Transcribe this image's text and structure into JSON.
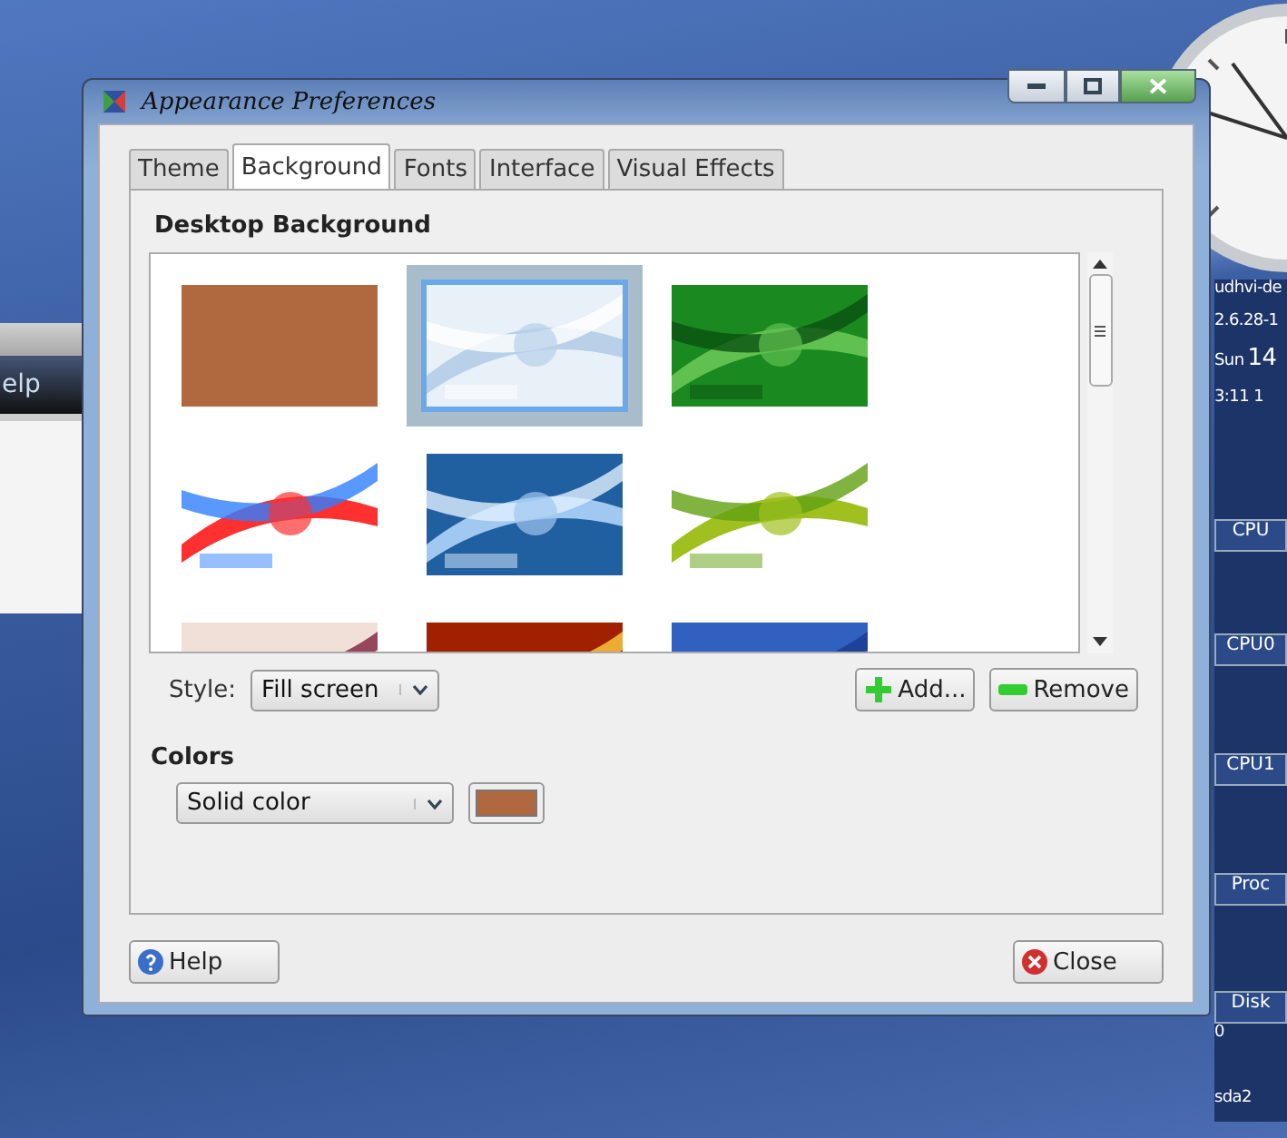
{
  "window": {
    "title": "Appearance Preferences"
  },
  "tabs": [
    {
      "label": "Theme",
      "selected": false
    },
    {
      "label": "Background",
      "selected": true
    },
    {
      "label": "Fonts",
      "selected": false
    },
    {
      "label": "Interface",
      "selected": false
    },
    {
      "label": "Visual Effects",
      "selected": false
    }
  ],
  "background": {
    "heading": "Desktop Background",
    "wallpapers": [
      {
        "kind": "solid",
        "color": "#b0693f",
        "selected": false
      },
      {
        "kind": "picture",
        "selected": true
      },
      {
        "kind": "picture",
        "selected": false
      },
      {
        "kind": "picture",
        "selected": false
      },
      {
        "kind": "picture",
        "selected": false
      },
      {
        "kind": "picture",
        "selected": false
      },
      {
        "kind": "picture",
        "selected": false
      },
      {
        "kind": "picture",
        "selected": false
      },
      {
        "kind": "picture",
        "selected": false
      }
    ],
    "style_label": "Style:",
    "style_value": "Fill screen",
    "add_button": "Add...",
    "remove_button": "Remove"
  },
  "colors": {
    "heading": "Colors",
    "mode": "Solid color",
    "color": "#b0693f"
  },
  "buttons": {
    "help": "Help",
    "close": "Close"
  },
  "behind_window": {
    "menu_text": "elp"
  },
  "monitor": [
    {
      "kind": "text",
      "text": "udhvi-de"
    },
    {
      "kind": "text",
      "text": "2.6.28-1"
    },
    {
      "kind": "date",
      "text": "Sun",
      "big": "14"
    },
    {
      "kind": "text",
      "text": "3:11 1"
    },
    {
      "kind": "header",
      "text": "CPU"
    },
    {
      "kind": "header",
      "text": "CPU0"
    },
    {
      "kind": "header",
      "text": "CPU1"
    },
    {
      "kind": "header",
      "text": "Proc"
    },
    {
      "kind": "header",
      "text": "Disk"
    },
    {
      "kind": "text",
      "text": "0"
    },
    {
      "kind": "text",
      "text": "sda2"
    }
  ]
}
